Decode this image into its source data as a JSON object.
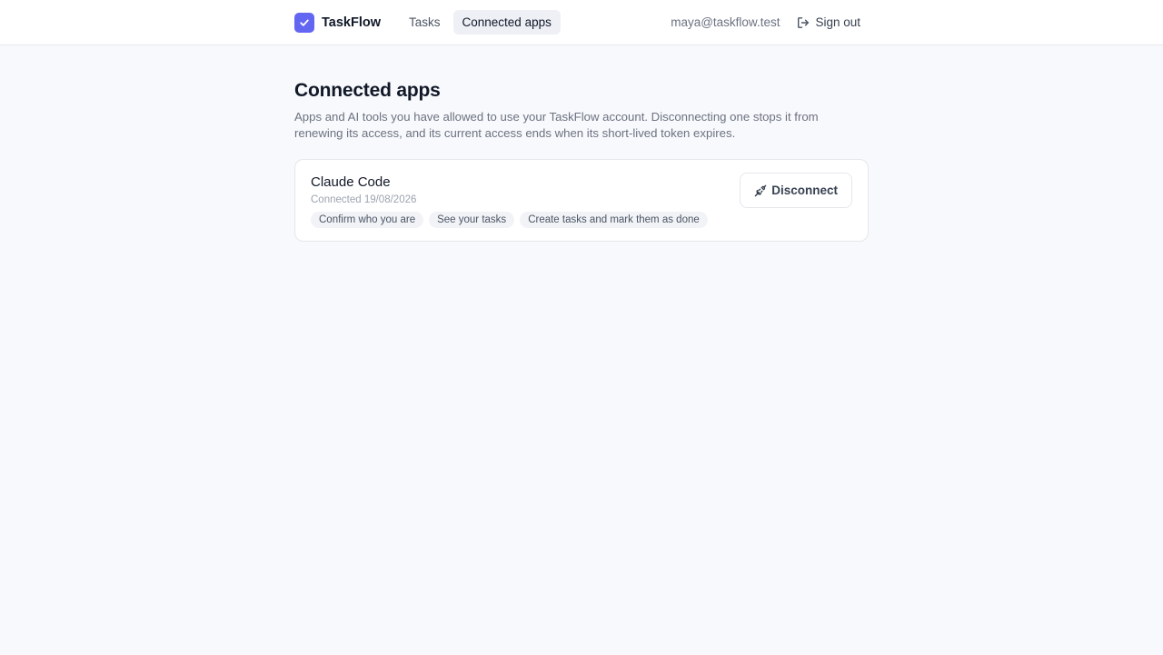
{
  "header": {
    "brand": "TaskFlow",
    "nav": [
      {
        "label": "Tasks"
      },
      {
        "label": "Connected apps"
      }
    ],
    "user_email": "maya@taskflow.test",
    "sign_out_label": "Sign out"
  },
  "page": {
    "title": "Connected apps",
    "description": "Apps and AI tools you have allowed to use your TaskFlow account. Disconnecting one stops it from renewing its access, and its current access ends when its short-lived token expires."
  },
  "apps": [
    {
      "name": "Claude Code",
      "connected": "Connected 19/08/2026",
      "scopes": [
        "Confirm who you are",
        "See your tasks",
        "Create tasks and mark them as done"
      ],
      "action_label": "Disconnect"
    }
  ],
  "colors": {
    "accent": "#6366f1",
    "background": "#f8f9fc"
  },
  "icons": {
    "logo": "check-icon",
    "sign_out": "sign-out-icon",
    "disconnect": "unplug-icon"
  }
}
